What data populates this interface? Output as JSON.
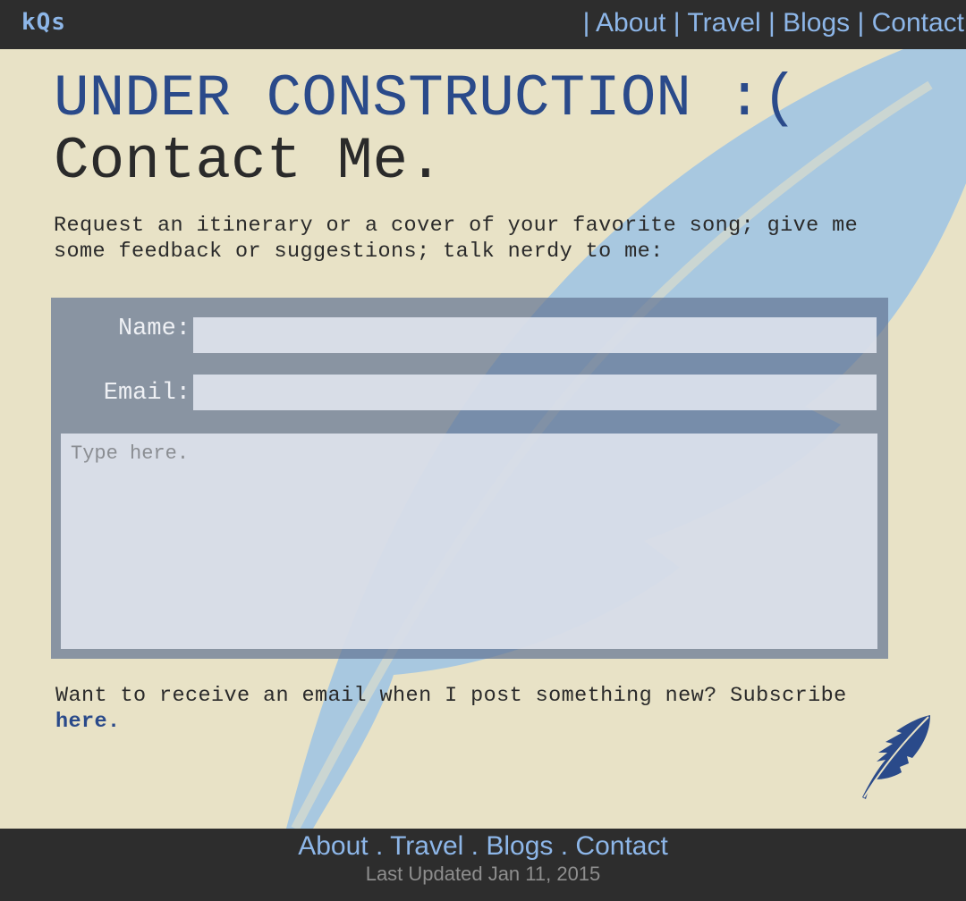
{
  "header": {
    "logo": "kQs",
    "nav": [
      {
        "sep": "| ",
        "label": "About"
      },
      {
        "sep": " | ",
        "label": "Travel"
      },
      {
        "sep": " | ",
        "label": "Blogs"
      },
      {
        "sep": " | ",
        "label": "Contact"
      }
    ]
  },
  "main": {
    "notice": "UNDER CONSTRUCTION :(",
    "title": "Contact Me.",
    "intro": "Request an itinerary or a cover of your favorite song; give me some feedback or suggestions; talk nerdy to me:",
    "form": {
      "name_label": "Name:",
      "name_value": "",
      "email_label": "Email:",
      "email_value": "",
      "message_placeholder": "Type here."
    },
    "subscribe_text": "Want to receive an email when I post something new? Subscribe ",
    "subscribe_link": "here."
  },
  "footer": {
    "nav": [
      {
        "label": "About",
        "sep": " . "
      },
      {
        "label": "Travel",
        "sep": " . "
      },
      {
        "label": "Blogs",
        "sep": " . "
      },
      {
        "label": "Contact",
        "sep": ""
      }
    ],
    "updated": "Last Updated Jan 11, 2015"
  },
  "colors": {
    "background": "#e8e2c6",
    "bar": "#2d2d2d",
    "link": "#8db6e8",
    "accent": "#2a4a8a",
    "feather": "#a8c8e0"
  },
  "icons": [
    "feather-icon"
  ]
}
